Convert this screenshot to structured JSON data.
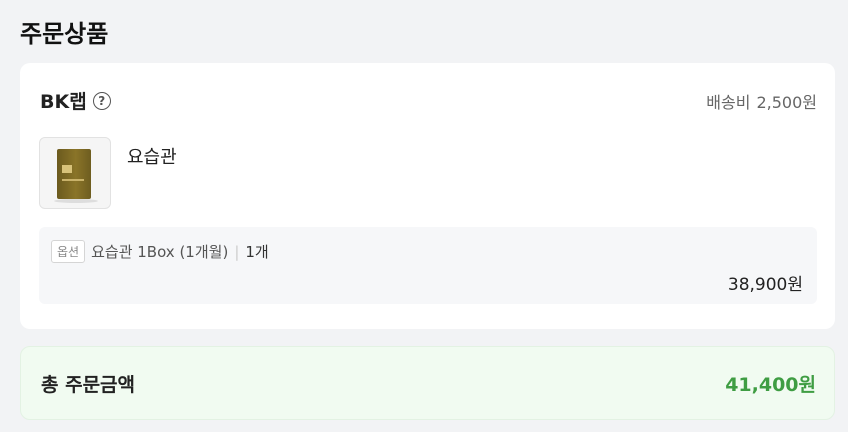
{
  "page": {
    "section_title": "주문상품"
  },
  "seller": {
    "name": "BK랩",
    "help_icon": "question-circle-icon",
    "shipping_label": "배송비",
    "shipping_fee": "2,500원"
  },
  "product": {
    "name": "요습관",
    "thumbnail": "product-box-image"
  },
  "option": {
    "tag": "옵션",
    "text": "요습관 1Box (1개월)",
    "separator": "|",
    "quantity": "1개",
    "price": "38,900원"
  },
  "total": {
    "label": "총 주문금액",
    "value": "41,400원",
    "accent_color": "#3f9d43"
  }
}
